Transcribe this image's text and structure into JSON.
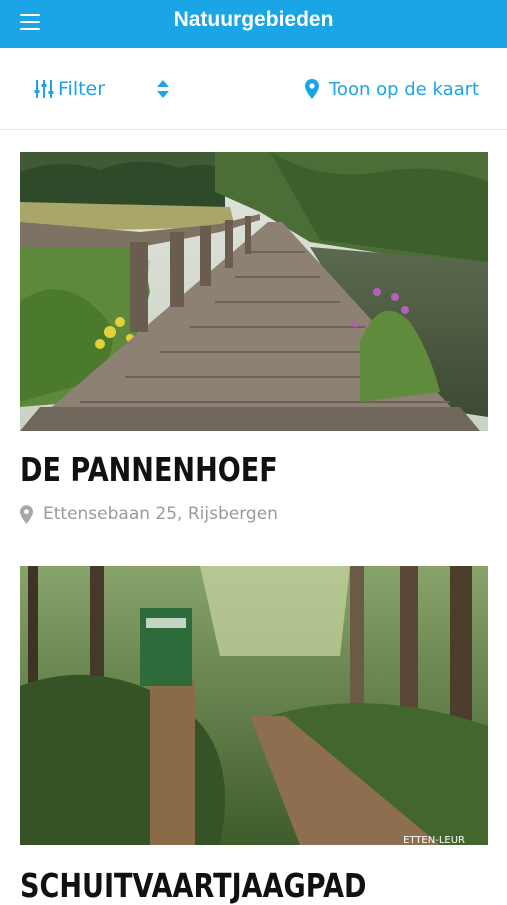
{
  "header": {
    "title": "Natuurgebieden",
    "menu_icon": "hamburger-menu-icon",
    "background": "#1aa6e6"
  },
  "toolbar": {
    "filter_label": "Filter",
    "filter_icon": "sliders-icon",
    "sort_icon": "sort-updown-icon",
    "map_label": "Toon op de kaart",
    "map_icon": "map-pin-icon",
    "accent": "#1aa6e6"
  },
  "places": [
    {
      "name": "DE PANNENHOEF",
      "address": "Ettensebaan 25, Rijsbergen",
      "photo_icon": "wooden-boardwalk-photo"
    },
    {
      "name": "SCHUITVAARTJAAGPAD",
      "photo_icon": "forest-path-photo",
      "photo_credit": "ETTEN-LEUR"
    }
  ]
}
